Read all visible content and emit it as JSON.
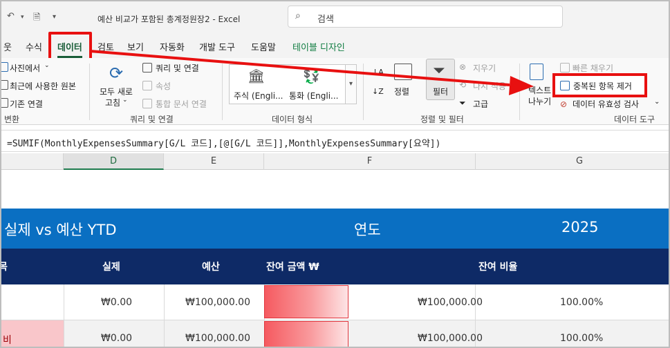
{
  "titlebar": {
    "title": "예산 비교가 포함된 총계정원장2  -  Excel",
    "search_placeholder": "검색"
  },
  "tabs": [
    {
      "label": "웃"
    },
    {
      "label": "수식"
    },
    {
      "label": "데이터"
    },
    {
      "label": "검토"
    },
    {
      "label": "보기"
    },
    {
      "label": "자동화"
    },
    {
      "label": "개발 도구"
    },
    {
      "label": "도움말"
    },
    {
      "label": "테이블 디자인"
    }
  ],
  "ribbon": {
    "get_data": {
      "photo": "사진에서",
      "recent": "최근에 사용한 원본",
      "existing": "기존 연결",
      "group": "변환"
    },
    "queries": {
      "refresh_all_line1": "모두 새로",
      "refresh_all_line2": "고침",
      "queries_connections": "쿼리 및 연결",
      "properties": "속성",
      "edit_links": "통합 문서 연결",
      "group": "쿼리 및 연결"
    },
    "data_types": {
      "stocks": "주식 (Engli...",
      "currency": "통화 (Engli...",
      "group": "데이터 형식"
    },
    "sort_filter": {
      "sort": "정렬",
      "filter": "필터",
      "clear": "지우기",
      "reapply": "다시 적용",
      "advanced": "고급",
      "group": "정렬 및 필터"
    },
    "data_tools": {
      "text_to_columns_line1": "텍스트",
      "text_to_columns_line2": "나누기",
      "flash_fill": "빠른 채우기",
      "remove_duplicates": "중복된 항목 제거",
      "data_validation": "데이터 유효성 검사",
      "group": "데이터 도구"
    }
  },
  "formula_bar": {
    "formula": "=SUMIF(MonthlyExpensesSummary[G/L 코드],[@[G/L 코드]],MonthlyExpensesSummary[요약])"
  },
  "columns": [
    "D",
    "E",
    "F",
    "G"
  ],
  "sheet": {
    "banner": {
      "title": "실제 vs 예산 YTD",
      "year_label": "연도",
      "year": "2025"
    },
    "headers": {
      "first": "목",
      "actual": "실제",
      "budget": "예산",
      "remaining": "잔여 금액 ₩",
      "ratio": "잔여 비율"
    },
    "rows": [
      {
        "label": "",
        "actual": "₩0.00",
        "budget": "₩100,000.00",
        "remaining": "₩100,000.00",
        "ratio": "100.00%"
      },
      {
        "label": "비",
        "actual": "₩0.00",
        "budget": "₩100,000.00",
        "remaining": "₩100,000.00",
        "ratio": "100.00%"
      }
    ]
  }
}
